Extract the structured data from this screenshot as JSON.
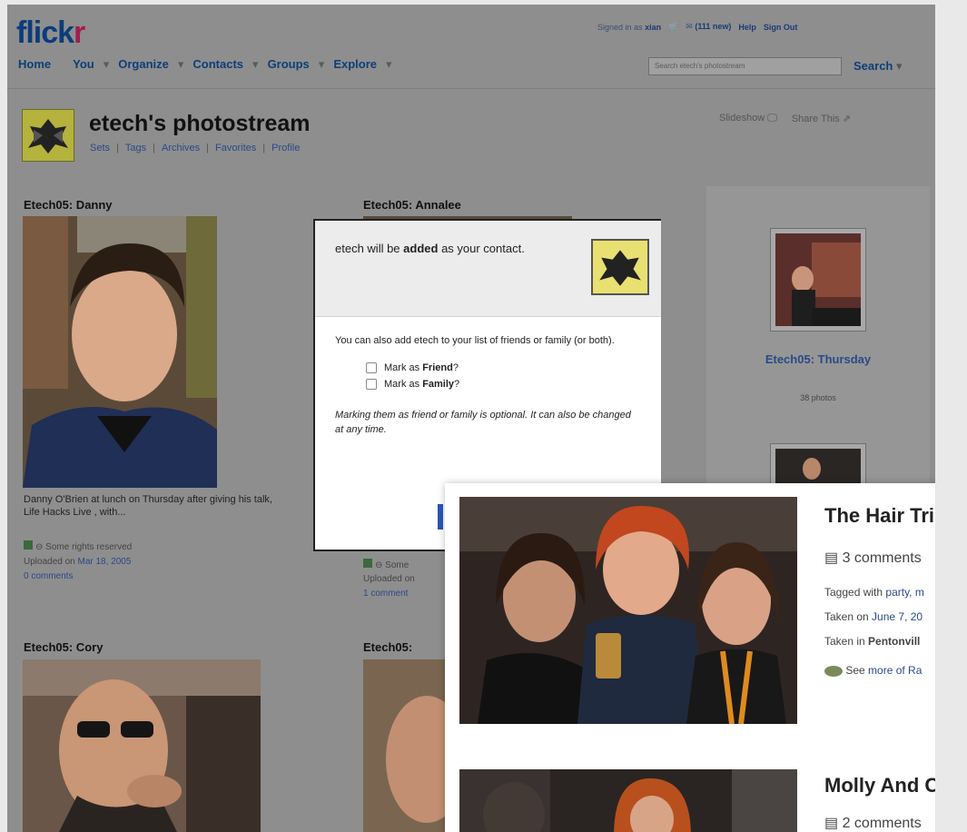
{
  "header": {
    "logo_main": "flick",
    "logo_r": "r",
    "signed_in": "Signed in as",
    "user": "xian",
    "mail": "(111 new)",
    "help": "Help",
    "signout": "Sign Out",
    "nav": [
      "Home",
      "You",
      "Organize",
      "Contacts",
      "Groups",
      "Explore"
    ],
    "search_placeholder": "Search etech's photostream",
    "search_btn": "Search"
  },
  "profile": {
    "title": "etech's photostream",
    "links": [
      "Sets",
      "Tags",
      "Archives",
      "Favorites",
      "Profile"
    ],
    "slideshow": "Slideshow",
    "share": "Share This"
  },
  "photos": [
    {
      "title": "Etech05: Danny",
      "caption": "Danny O'Brien at lunch on Thursday after giving his talk, Life Hacks Live , with...",
      "rights": "Some rights reserved",
      "uploaded": "Uploaded on",
      "date": "Mar 18, 2005",
      "comments": "0 comments"
    },
    {
      "title": "Etech05: Annalee",
      "rights": "Some",
      "uploaded": "Uploaded on",
      "comments": "1 comment"
    },
    {
      "title": "Etech05: Cory"
    },
    {
      "title": "Etech05:"
    }
  ],
  "sidebar": {
    "set_title": "Etech05: Thursday",
    "count": "38 photos"
  },
  "dialog": {
    "line1a": "etech will be ",
    "line1b": "added",
    "line1c": " as your contact.",
    "p1": "You can also add etech to your list of friends or family (or both).",
    "friend_pre": "Mark as ",
    "friend": "Friend",
    "friend_post": "?",
    "family_pre": "Mark as ",
    "family": "Family",
    "family_post": "?",
    "note": "Marking them as friend or family is optional. It can also be changed at any time."
  },
  "overlay": {
    "item1": {
      "title": "The Hair Tri",
      "comments": "3 comments",
      "tagged": "Tagged with ",
      "tags": "party, m",
      "taken": "Taken on ",
      "date": "June 7, 20",
      "place_pre": "Taken in ",
      "place": "Pentonvill",
      "more_pre": "See ",
      "more": "more of Ra"
    },
    "item2": {
      "title": "Molly And C",
      "comments": "2 comments"
    }
  }
}
